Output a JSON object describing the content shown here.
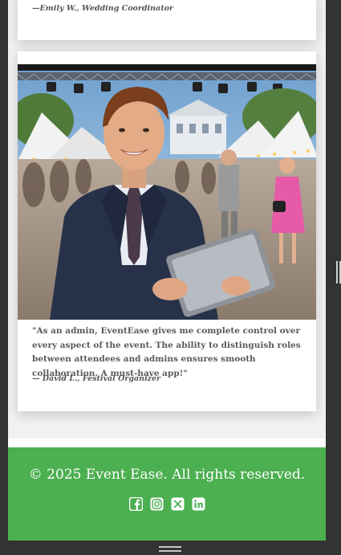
{
  "testimonials": [
    {
      "author": "—Emily W., Wedding Coordinator"
    },
    {
      "image_alt": "Smiling event admin holding a tablet at an outdoor festival",
      "quote": "\"As an admin, EventEase gives me complete control over every aspect of the event. The ability to distinguish roles between attendees and admins ensures smooth collaboration. A must-have app!\"",
      "author": "— David L., Festival Organizer"
    }
  ],
  "footer": {
    "copyright": "© 2025 Event Ease. All rights reserved.",
    "socials": [
      {
        "name": "facebook-icon"
      },
      {
        "name": "instagram-icon"
      },
      {
        "name": "x-twitter-icon"
      },
      {
        "name": "linkedin-icon"
      }
    ]
  },
  "colors": {
    "footer_bg": "#4caf50",
    "frame_bg": "#333333",
    "page_bg": "#f1f1f1"
  }
}
